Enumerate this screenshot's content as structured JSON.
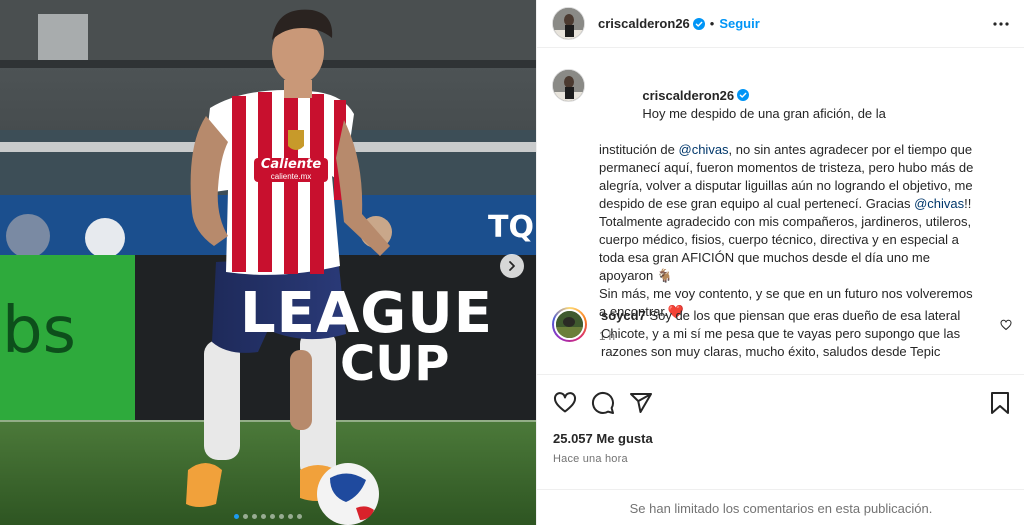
{
  "post": {
    "username": "criscalderon26",
    "follow_label": "Seguir",
    "separator": "•"
  },
  "caption": {
    "username": "criscalderon26",
    "lines": [
      "Hoy me despido de una gran afición, de la",
      "institución de ",
      "@chivas",
      ", no sin antes agradecer por el tiempo que",
      "permanecí aquí, fueron momentos de tristeza, pero hubo más de",
      "alegría, volver a disputar liguillas aún no logrando el objetivo, me",
      "despido de ese gran equipo al cual pertenecí. Gracias ",
      "@chivas",
      "!!",
      "Totalmente agradecido con mis compañeros, jardineros, utileros,",
      "cuerpo médico, fisios, cuerpo técnico, directiva y en especial a",
      "toda esa gran AFICIÓN que muchos desde el día uno me",
      "apoyaron 🐐",
      "Sin más, me voy contento, y se que en un futuro nos volveremos",
      "a encontrar.",
      "❤️"
    ],
    "time": "1 h"
  },
  "comment": {
    "username": "soycd7",
    "line1": "Soy de los que piensan que eras dueño de esa lateral",
    "line2": "Chicote, y a mi sí me pesa que te vayas pero supongo que las",
    "line3": "razones son muy claras, mucho éxito, saludos desde Tepic"
  },
  "stats": {
    "likes": "25.057 Me gusta",
    "posted": "Hace una hora"
  },
  "footer": {
    "limited": "Se han limitado los comentarios en esta publicación."
  },
  "media_overlay": {
    "jersey_sponsor": "Caliente",
    "jersey_sponsor_sub": "caliente.mx",
    "ad_board_1": "LEAGUE",
    "ad_board_2": "CUP",
    "ad_board_left": "bs",
    "ad_board_top": "TQ"
  },
  "carousel": {
    "count": 8,
    "active_index": 0
  },
  "colors": {
    "accent": "#0095f6",
    "verified": "#0095f6",
    "mention": "#00376b",
    "jersey_red": "#c8102e"
  }
}
